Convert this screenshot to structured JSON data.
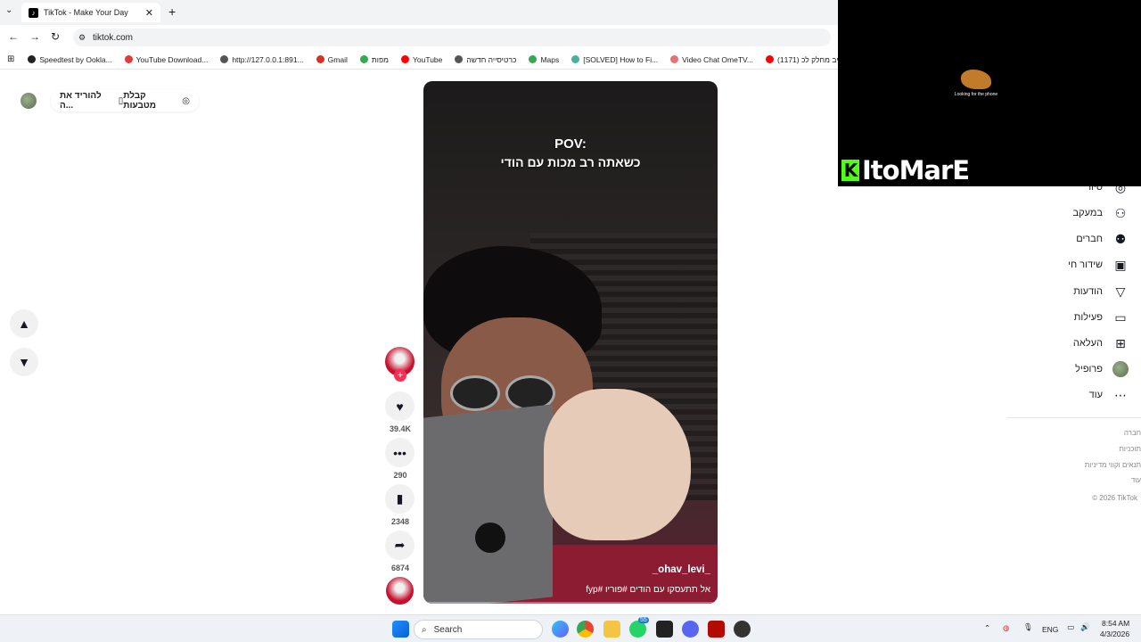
{
  "browser": {
    "tab_title": "TikTok - Make Your Day",
    "url": "tiktok.com",
    "bookmarks": [
      {
        "label": "Speedtest by Ookla...",
        "color": "#222"
      },
      {
        "label": "YouTube Download...",
        "color": "#e53935"
      },
      {
        "label": "http://127.0.0.1:891...",
        "color": "#555"
      },
      {
        "label": "Gmail",
        "color": "#d93025"
      },
      {
        "label": "מפות",
        "color": "#34a853"
      },
      {
        "label": "YouTube",
        "color": "#ff0000"
      },
      {
        "label": "כרטיסייה חדשה",
        "color": "#555"
      },
      {
        "label": "Maps",
        "color": "#34a853"
      },
      {
        "label": "[SOLVED] How to Fi...",
        "color": "#4caf9a"
      },
      {
        "label": "Video Chat OmeTV...",
        "color": "#e57373"
      },
      {
        "label": "(1171) לייב מחלק לכ...",
        "color": "#ff0000"
      }
    ]
  },
  "page": {
    "get_coins": "קבלת מטבעות",
    "download_app": "להוריד את ה...",
    "nav_up": "⌃",
    "nav_down": "⌄"
  },
  "video": {
    "overlay_line1": "POV:",
    "overlay_line2": "כשאתה רב מכות עם הודי",
    "username": "_ohav_levi_",
    "description": "אל תתעסקו עם הודים #פוריו #fyp"
  },
  "actions": {
    "likes": "39.4K",
    "comments": "290",
    "saves": "2348",
    "shares": "6874"
  },
  "sidebar": {
    "items": [
      {
        "label": "סיור",
        "icon": "compass-icon",
        "glyph": "◎"
      },
      {
        "label": "במעקב",
        "icon": "following-icon",
        "glyph": "⚇"
      },
      {
        "label": "חברים",
        "icon": "friends-icon",
        "glyph": "⚉"
      },
      {
        "label": "שידור חי",
        "icon": "live-icon",
        "glyph": "▣"
      },
      {
        "label": "הודעות",
        "icon": "messages-icon",
        "glyph": "▽"
      },
      {
        "label": "פעילות",
        "icon": "activity-icon",
        "glyph": "▭"
      },
      {
        "label": "העלאה",
        "icon": "upload-icon",
        "glyph": "⊞"
      },
      {
        "label": "פרופיל",
        "icon": "profile-avatar",
        "glyph": ""
      },
      {
        "label": "עוד",
        "icon": "more-icon",
        "glyph": "⋯"
      }
    ],
    "footer": [
      "חברה",
      "תוכניות",
      "תנאים וקווי מדיניות",
      "עוד",
      "© 2026 TikTok"
    ]
  },
  "overlay": {
    "loading_text": "Looking for the phone",
    "brand": "ItoMarE",
    "brand_k": "K"
  },
  "taskbar": {
    "search_label": "Search",
    "language": "ENG",
    "time": "8:54 AM",
    "date": "4/3/2026",
    "chrome_badge": "55"
  }
}
